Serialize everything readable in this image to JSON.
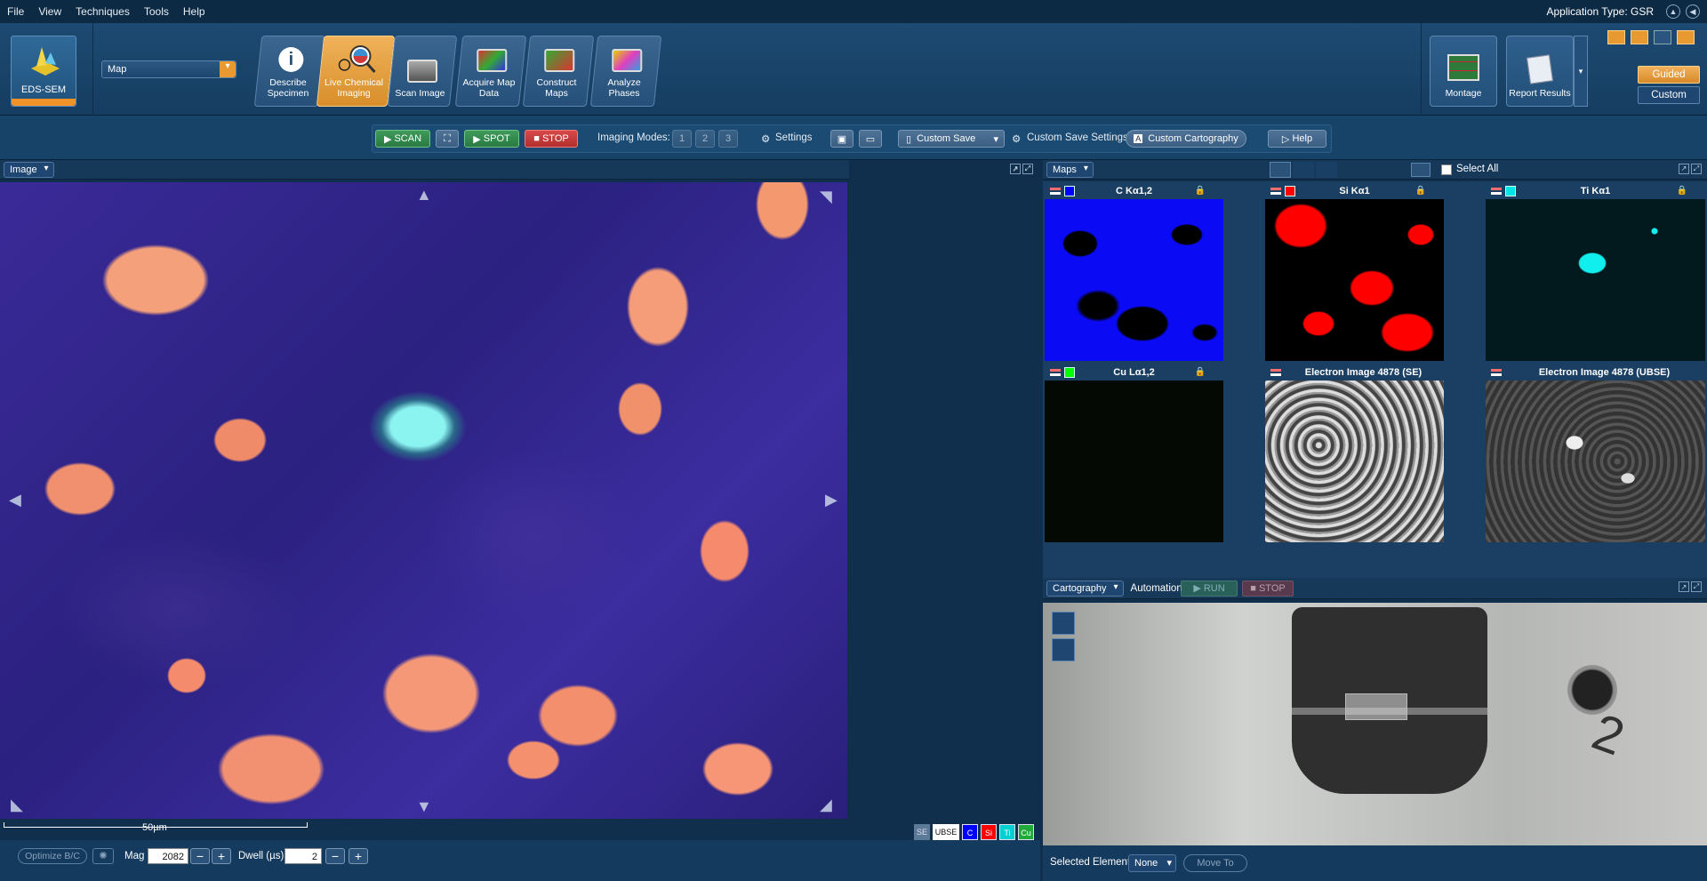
{
  "menubar": {
    "items": [
      "File",
      "View",
      "Techniques",
      "Tools",
      "Help"
    ],
    "app_type": "Application Type: GSR"
  },
  "ribbon": {
    "app_tile": "EDS-SEM",
    "mode_select": "Map",
    "workflow": [
      {
        "label": "Describe Specimen",
        "icon": "info-icon"
      },
      {
        "label": "Live Chemical Imaging",
        "icon": "magnifier-icon",
        "active": true
      },
      {
        "label": "Scan Image",
        "icon": "scan-image-icon"
      },
      {
        "label": "Acquire Map Data",
        "icon": "acquire-map-icon"
      },
      {
        "label": "Construct Maps",
        "icon": "construct-maps-icon"
      },
      {
        "label": "Analyze Phases",
        "icon": "analyze-phases-icon"
      }
    ],
    "montage": "Montage",
    "report": "Report Results",
    "guided": "Guided",
    "custom": "Custom"
  },
  "toolbar": {
    "scan": "SCAN",
    "spot": "SPOT",
    "stop": "STOP",
    "imaging_modes": "Imaging Modes:",
    "mode_buttons": [
      "1",
      "2",
      "3"
    ],
    "settings": "Settings",
    "custom_save": "Custom Save",
    "custom_save_settings": "Custom Save Settings",
    "custom_cartography": "Custom Cartography",
    "help": "Help"
  },
  "image_panel": {
    "dropdown": "Image",
    "scalebar": "50µm"
  },
  "maps_panel": {
    "dropdown": "Maps",
    "select_all": "Select All",
    "tiles": [
      {
        "title": "C Kα1,2",
        "color": "#0000ff"
      },
      {
        "title": "Si Kα1",
        "color": "#ff0000"
      },
      {
        "title": "Ti Kα1",
        "color": "#00e5e5"
      },
      {
        "title": "Cu Lα1,2",
        "color": "#00ff00"
      },
      {
        "title": "Electron Image 4878 (SE)",
        "color": ""
      },
      {
        "title": "Electron Image 4878 (UBSE)",
        "color": ""
      }
    ]
  },
  "cartography": {
    "dropdown": "Cartography",
    "automation": "Automation",
    "run": "RUN",
    "stop": "STOP",
    "sample_label": "2"
  },
  "bottombar": {
    "optimize": "Optimize B/C",
    "mag_label": "Mag",
    "mag_value": "2082",
    "dwell_label": "Dwell (µs)",
    "dwell_value": "2",
    "selected_element": "Selected Element",
    "element_value": "None",
    "move_to": "Move To",
    "channels": [
      "SE",
      "UBSE",
      "C",
      "Si",
      "Ti",
      "Cu"
    ],
    "channel_colors": [
      "#5a7a98",
      "#ffffff",
      "#0000ff",
      "#ff0000",
      "#00d0d0",
      "#1faa3a"
    ]
  }
}
